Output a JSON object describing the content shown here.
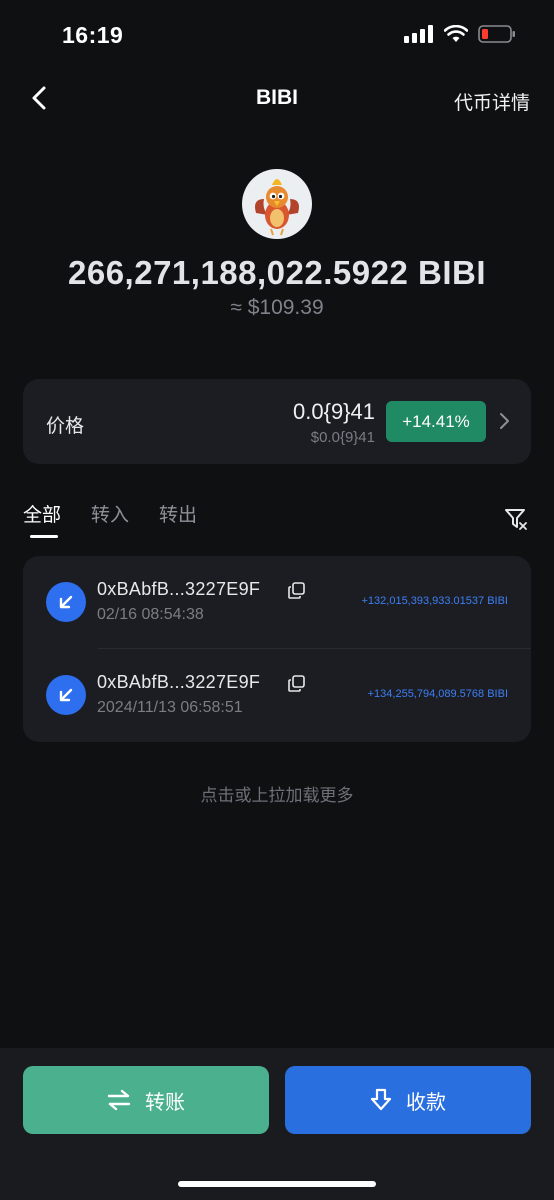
{
  "status_bar": {
    "time": "16:19"
  },
  "nav": {
    "title": "BIBI",
    "right_link": "代币详情"
  },
  "token": {
    "balance": "266,271,188,022.5922 BIBI",
    "fiat_value": "≈ $109.39"
  },
  "price": {
    "label": "价格",
    "value": "0.0{9}41",
    "fiat": "$0.0{9}41",
    "change": "+14.41%",
    "change_color": "#1f8a63"
  },
  "tabs": [
    {
      "label": "全部"
    },
    {
      "label": "转入"
    },
    {
      "label": "转出"
    }
  ],
  "transactions": [
    {
      "address": "0xBAbfB...3227E9F",
      "time": "02/16 08:54:38",
      "amount": "+132,015,393,933.01537 BIBI"
    },
    {
      "address": "0xBAbfB...3227E9F",
      "time": "2024/11/13 06:58:51",
      "amount": "+134,255,794,089.5768 BIBI"
    }
  ],
  "load_more": "点击或上拉加载更多",
  "actions": {
    "transfer": "转账",
    "receive": "收款"
  },
  "colors": {
    "accent_blue": "#2a6fe0",
    "accent_green": "#4ab08e",
    "background": "#0f1012"
  }
}
